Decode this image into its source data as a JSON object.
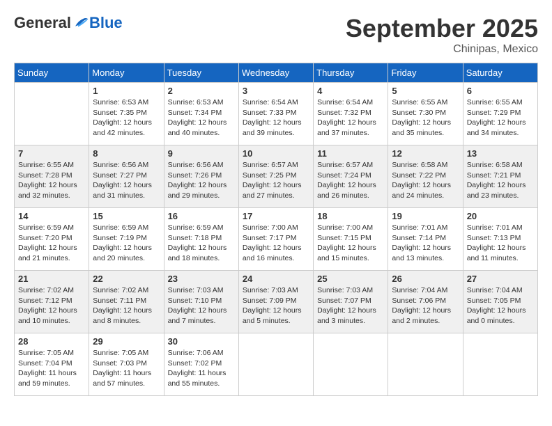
{
  "logo": {
    "general": "General",
    "blue": "Blue"
  },
  "title": {
    "month": "September 2025",
    "location": "Chinipas, Mexico"
  },
  "days_of_week": [
    "Sunday",
    "Monday",
    "Tuesday",
    "Wednesday",
    "Thursday",
    "Friday",
    "Saturday"
  ],
  "weeks": [
    [
      {
        "day": "",
        "info": ""
      },
      {
        "day": "1",
        "info": "Sunrise: 6:53 AM\nSunset: 7:35 PM\nDaylight: 12 hours\nand 42 minutes."
      },
      {
        "day": "2",
        "info": "Sunrise: 6:53 AM\nSunset: 7:34 PM\nDaylight: 12 hours\nand 40 minutes."
      },
      {
        "day": "3",
        "info": "Sunrise: 6:54 AM\nSunset: 7:33 PM\nDaylight: 12 hours\nand 39 minutes."
      },
      {
        "day": "4",
        "info": "Sunrise: 6:54 AM\nSunset: 7:32 PM\nDaylight: 12 hours\nand 37 minutes."
      },
      {
        "day": "5",
        "info": "Sunrise: 6:55 AM\nSunset: 7:30 PM\nDaylight: 12 hours\nand 35 minutes."
      },
      {
        "day": "6",
        "info": "Sunrise: 6:55 AM\nSunset: 7:29 PM\nDaylight: 12 hours\nand 34 minutes."
      }
    ],
    [
      {
        "day": "7",
        "info": "Sunrise: 6:55 AM\nSunset: 7:28 PM\nDaylight: 12 hours\nand 32 minutes."
      },
      {
        "day": "8",
        "info": "Sunrise: 6:56 AM\nSunset: 7:27 PM\nDaylight: 12 hours\nand 31 minutes."
      },
      {
        "day": "9",
        "info": "Sunrise: 6:56 AM\nSunset: 7:26 PM\nDaylight: 12 hours\nand 29 minutes."
      },
      {
        "day": "10",
        "info": "Sunrise: 6:57 AM\nSunset: 7:25 PM\nDaylight: 12 hours\nand 27 minutes."
      },
      {
        "day": "11",
        "info": "Sunrise: 6:57 AM\nSunset: 7:24 PM\nDaylight: 12 hours\nand 26 minutes."
      },
      {
        "day": "12",
        "info": "Sunrise: 6:58 AM\nSunset: 7:22 PM\nDaylight: 12 hours\nand 24 minutes."
      },
      {
        "day": "13",
        "info": "Sunrise: 6:58 AM\nSunset: 7:21 PM\nDaylight: 12 hours\nand 23 minutes."
      }
    ],
    [
      {
        "day": "14",
        "info": "Sunrise: 6:59 AM\nSunset: 7:20 PM\nDaylight: 12 hours\nand 21 minutes."
      },
      {
        "day": "15",
        "info": "Sunrise: 6:59 AM\nSunset: 7:19 PM\nDaylight: 12 hours\nand 20 minutes."
      },
      {
        "day": "16",
        "info": "Sunrise: 6:59 AM\nSunset: 7:18 PM\nDaylight: 12 hours\nand 18 minutes."
      },
      {
        "day": "17",
        "info": "Sunrise: 7:00 AM\nSunset: 7:17 PM\nDaylight: 12 hours\nand 16 minutes."
      },
      {
        "day": "18",
        "info": "Sunrise: 7:00 AM\nSunset: 7:15 PM\nDaylight: 12 hours\nand 15 minutes."
      },
      {
        "day": "19",
        "info": "Sunrise: 7:01 AM\nSunset: 7:14 PM\nDaylight: 12 hours\nand 13 minutes."
      },
      {
        "day": "20",
        "info": "Sunrise: 7:01 AM\nSunset: 7:13 PM\nDaylight: 12 hours\nand 11 minutes."
      }
    ],
    [
      {
        "day": "21",
        "info": "Sunrise: 7:02 AM\nSunset: 7:12 PM\nDaylight: 12 hours\nand 10 minutes."
      },
      {
        "day": "22",
        "info": "Sunrise: 7:02 AM\nSunset: 7:11 PM\nDaylight: 12 hours\nand 8 minutes."
      },
      {
        "day": "23",
        "info": "Sunrise: 7:03 AM\nSunset: 7:10 PM\nDaylight: 12 hours\nand 7 minutes."
      },
      {
        "day": "24",
        "info": "Sunrise: 7:03 AM\nSunset: 7:09 PM\nDaylight: 12 hours\nand 5 minutes."
      },
      {
        "day": "25",
        "info": "Sunrise: 7:03 AM\nSunset: 7:07 PM\nDaylight: 12 hours\nand 3 minutes."
      },
      {
        "day": "26",
        "info": "Sunrise: 7:04 AM\nSunset: 7:06 PM\nDaylight: 12 hours\nand 2 minutes."
      },
      {
        "day": "27",
        "info": "Sunrise: 7:04 AM\nSunset: 7:05 PM\nDaylight: 12 hours\nand 0 minutes."
      }
    ],
    [
      {
        "day": "28",
        "info": "Sunrise: 7:05 AM\nSunset: 7:04 PM\nDaylight: 11 hours\nand 59 minutes."
      },
      {
        "day": "29",
        "info": "Sunrise: 7:05 AM\nSunset: 7:03 PM\nDaylight: 11 hours\nand 57 minutes."
      },
      {
        "day": "30",
        "info": "Sunrise: 7:06 AM\nSunset: 7:02 PM\nDaylight: 11 hours\nand 55 minutes."
      },
      {
        "day": "",
        "info": ""
      },
      {
        "day": "",
        "info": ""
      },
      {
        "day": "",
        "info": ""
      },
      {
        "day": "",
        "info": ""
      }
    ]
  ]
}
